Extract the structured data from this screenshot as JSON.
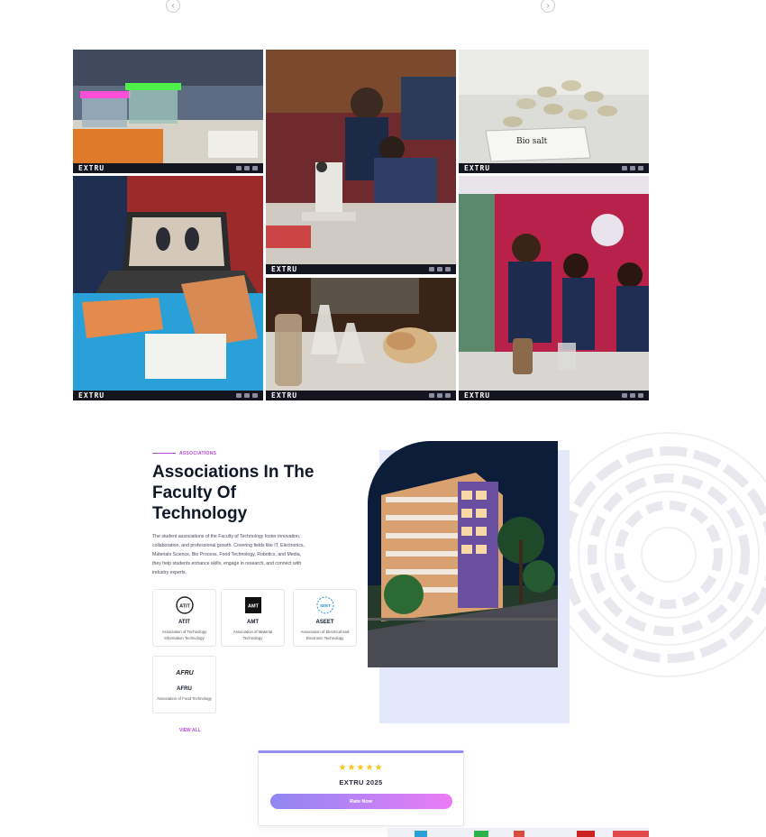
{
  "carousel": {
    "prev_icon": "chevron-left-icon",
    "next_icon": "chevron-right-icon",
    "prev_glyph": "‹",
    "next_glyph": "›"
  },
  "gallery": {
    "photos": [
      {
        "id": "boxes",
        "alt": "Exhibit with translucent pink and green boxes",
        "brand": "EXTRU"
      },
      {
        "id": "microscope",
        "alt": "Students using a microscope",
        "brand": "EXTRU"
      },
      {
        "id": "biosalt",
        "alt": "Bio salt tablets on a plate",
        "brand": "EXTRU",
        "caption": "Bio salt"
      },
      {
        "id": "footprints",
        "alt": "Laptop showing footprint models",
        "brand": "EXTRU"
      },
      {
        "id": "flasks",
        "alt": "Flasks and material samples on display",
        "brand": "EXTRU"
      },
      {
        "id": "students",
        "alt": "Students presenting at the stall",
        "brand": "EXTRU"
      }
    ]
  },
  "associations": {
    "kicker": "ASSOCIATIONS",
    "heading": "Associations In The Faculty Of Technology",
    "description": "The student associations of the Faculty of Technology foster innovation, collaboration, and professional growth. Covering fields like IT, Electronics, Materials Science, Bio Process, Food Technology, Robotics, and Media, they help students enhance skills, engage in research, and connect with industry experts.",
    "cards": [
      {
        "abbr": "ATIT",
        "full": "Association of Technology Information Technology",
        "logo_text": "ATIT"
      },
      {
        "abbr": "AMT",
        "full": "Association of Material Technology",
        "logo_text": "AMT"
      },
      {
        "abbr": "ASEET",
        "full": "Association of Electrical and Electronic Technology",
        "logo_text": "SEET"
      },
      {
        "abbr": "AFRU",
        "full": "Association of Food Technology",
        "logo_text": "AFRU"
      }
    ],
    "view_all": "VIEW ALL"
  },
  "rating": {
    "stars": "★★★★★",
    "title": "EXTRU 2025",
    "button": "Rate Now"
  },
  "colors": {
    "accent": "#b24ad6",
    "gradient_start": "#8f86f2",
    "gradient_end": "#ea7cf5",
    "star": "#f5c518",
    "hero_panel": "#e4e8fb"
  }
}
